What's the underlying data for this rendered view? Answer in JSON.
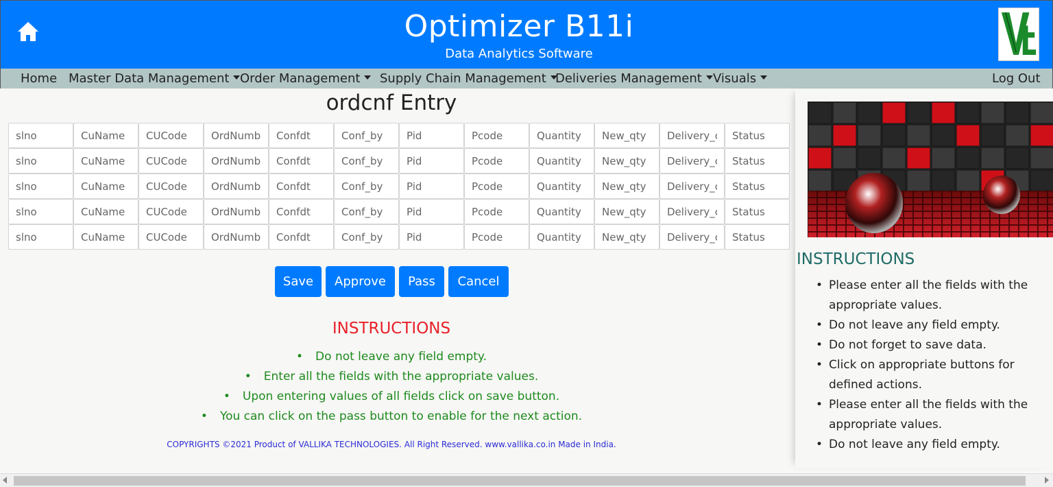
{
  "header": {
    "title": "Optimizer B11i",
    "subtitle": "Data Analytics Software",
    "home_icon": "home-icon",
    "logo_icon": "vt-logo"
  },
  "nav": {
    "items": [
      {
        "label": "Home",
        "dropdown": false
      },
      {
        "label": "Master Data Management",
        "dropdown": true
      },
      {
        "label": "Order Management",
        "dropdown": true
      },
      {
        "label": "Supply Chain Management",
        "dropdown": true
      },
      {
        "label": "Deliveries Management",
        "dropdown": true
      },
      {
        "label": "Visuals",
        "dropdown": true
      }
    ],
    "logout": "Log Out"
  },
  "main": {
    "title": "ordcnf Entry",
    "fields": [
      "slno",
      "CuName",
      "CUCode",
      "OrdNumb",
      "Confdt",
      "Conf_by",
      "Pid",
      "Pcode",
      "Quantity",
      "New_qty",
      "Delivery_c",
      "Status"
    ],
    "row_count": 5,
    "buttons": {
      "save": "Save",
      "approve": "Approve",
      "pass": "Pass",
      "cancel": "Cancel"
    },
    "instructions": {
      "title": "INSTRUCTIONS",
      "items": [
        "Do not leave any field empty.",
        "Enter all the fields with the appropriate values.",
        "Upon entering values of all fields click on save button.",
        "You can click on the pass button to enable for the next action."
      ]
    },
    "copyright": "COPYRIGHTS ©2021 Product of VALLIKA TECHNOLOGIES. All Right Reserved. www.vallika.co.in Made in India."
  },
  "sidebar": {
    "title": "INSTRUCTIONS",
    "items": [
      "Please enter all the fields with the appropriate values.",
      "Do not leave any field empty.",
      "Do not forget to save data.",
      "Click on appropriate buttons for defined actions.",
      "Please enter all the fields with the appropriate values.",
      "Do not leave any field empty."
    ]
  },
  "colors": {
    "header_bg": "#007bff",
    "nav_bg": "#b3c6c6",
    "button_bg": "#007bff",
    "instructions_title": "#e8202a",
    "instructions_text": "#1e8a1e",
    "sidebar_title": "#1d6b66",
    "copyright": "#2b2bd6"
  }
}
